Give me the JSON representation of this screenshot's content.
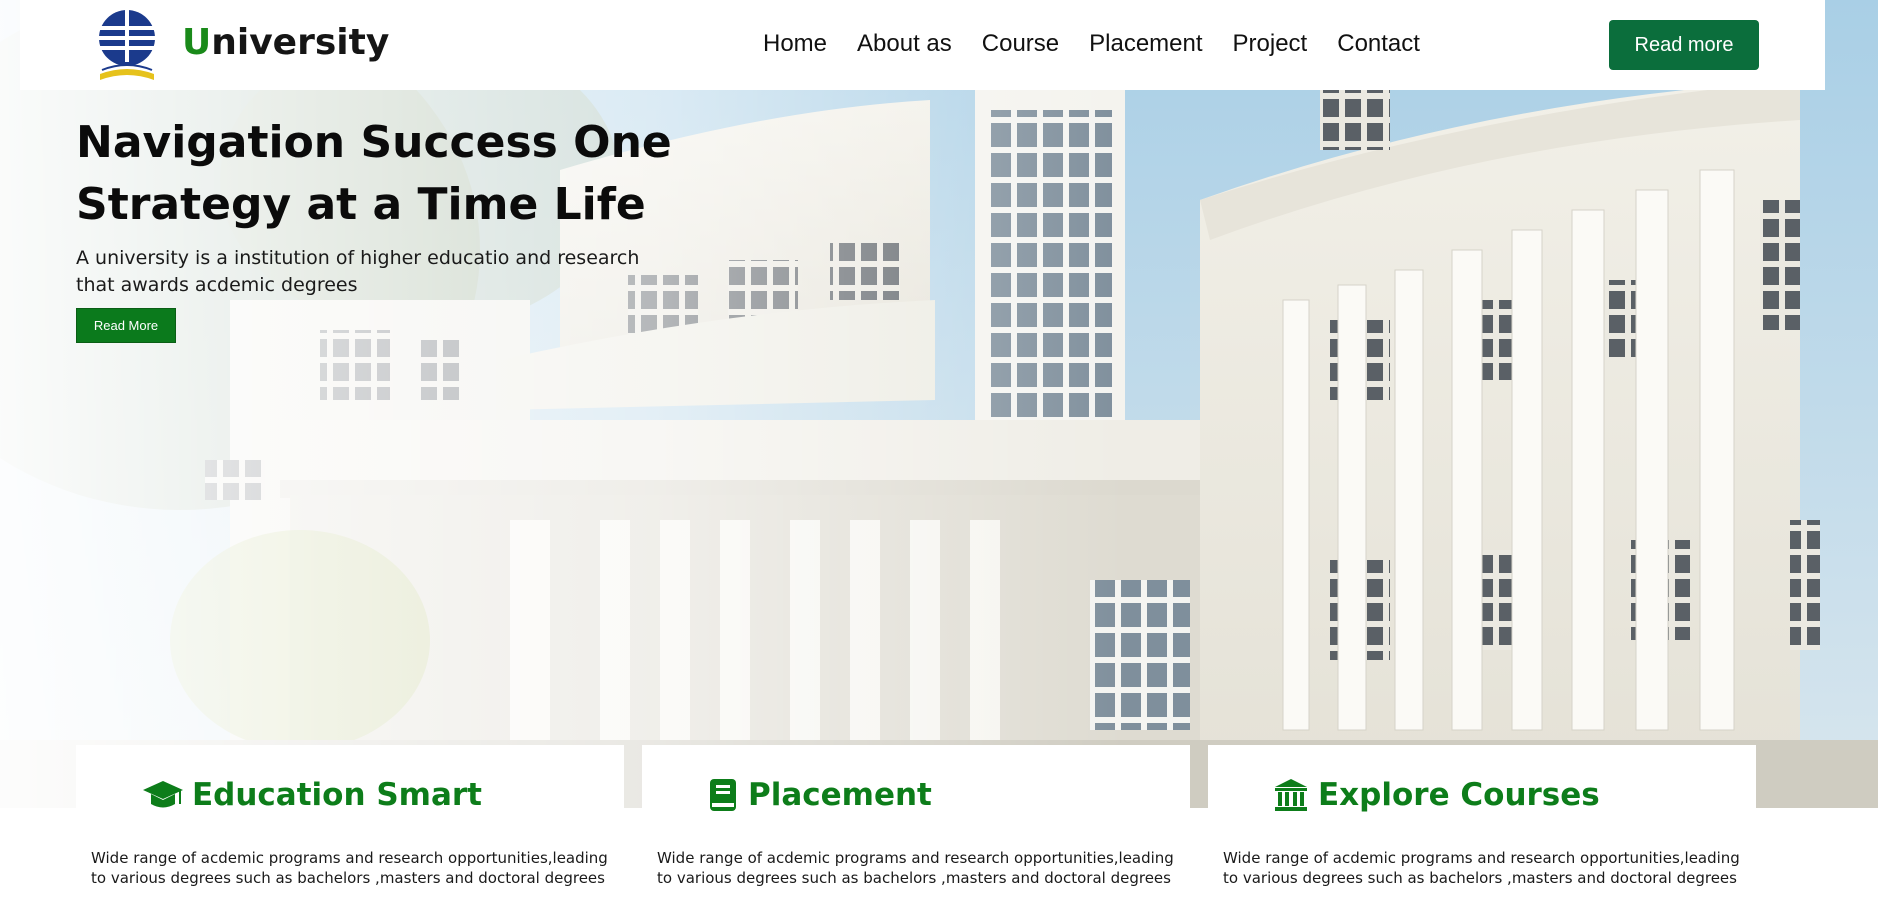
{
  "colors": {
    "brand_green": "#1a8a1a",
    "button_green": "#0b6e3c",
    "heading_green": "#0d7d1a"
  },
  "navbar": {
    "brand_first": "U",
    "brand_rest": "niversity",
    "logo": "university-logo-icon",
    "links": [
      "Home",
      "About as",
      "Course",
      "Placement",
      "Project",
      "Contact"
    ],
    "cta_label": "Read more"
  },
  "hero": {
    "title": "Navigation Success One Strategy at a Time Life",
    "subtitle": "A university is a institution of higher educatio and research that awards acdemic degrees",
    "button_label": "Read More",
    "background": "university-building-photo"
  },
  "cards": [
    {
      "icon": "graduation-cap-icon",
      "title": "Education Smart",
      "text": "Wide range of acdemic programs and research opportunities,leading to various degrees such as bachelors ,masters and doctoral degrees"
    },
    {
      "icon": "book-icon",
      "title": "Placement",
      "text": "Wide range of acdemic programs and research opportunities,leading to various degrees such as bachelors ,masters and doctoral degrees"
    },
    {
      "icon": "bank-building-icon",
      "title": "Explore Courses",
      "text": "Wide range of acdemic programs and research opportunities,leading to various degrees such as bachelors ,masters and doctoral degrees"
    }
  ]
}
